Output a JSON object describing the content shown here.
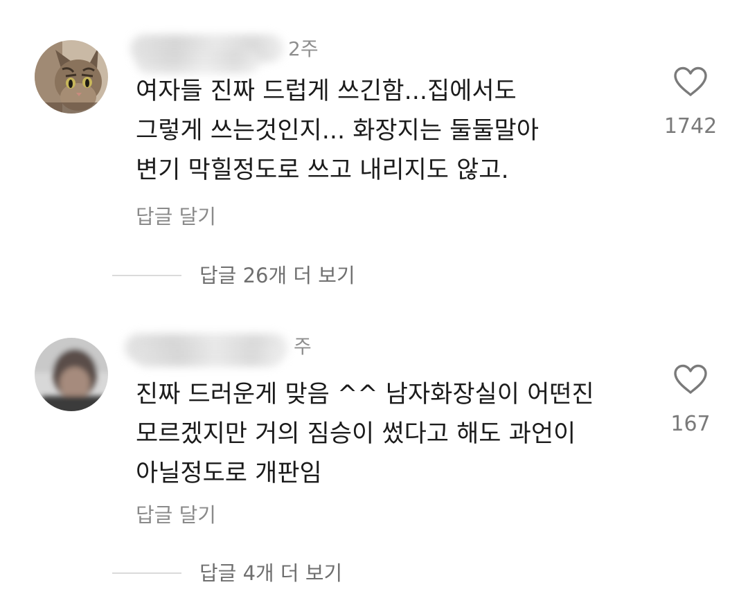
{
  "comments": [
    {
      "time": "2주",
      "text": "여자들 진짜 드럽게 쓰긴함...집에서도\n그렇게 쓰는것인지... 화장지는 둘둘말아\n변기 막힐정도로 쓰고 내리지도 않고.",
      "reply_label": "답글 달기",
      "more_replies": "답글 26개 더 보기",
      "likes": "1742",
      "avatar_icon": "cat-avatar-icon"
    },
    {
      "time": "주",
      "text": "진짜 드러운게 맞음 ^^ 남자화장실이 어떤진\n모르겠지만 거의 짐승이 썼다고 해도 과언이\n아닐정도로 개판임",
      "reply_label": "답글 달기",
      "more_replies": "답글 4개 더 보기",
      "likes": "167",
      "avatar_icon": "blurred-person-avatar-icon"
    }
  ],
  "colors": {
    "text": "#1b1b1b",
    "muted": "#8a8a8a",
    "heart_outline": "#7a7a7a"
  }
}
